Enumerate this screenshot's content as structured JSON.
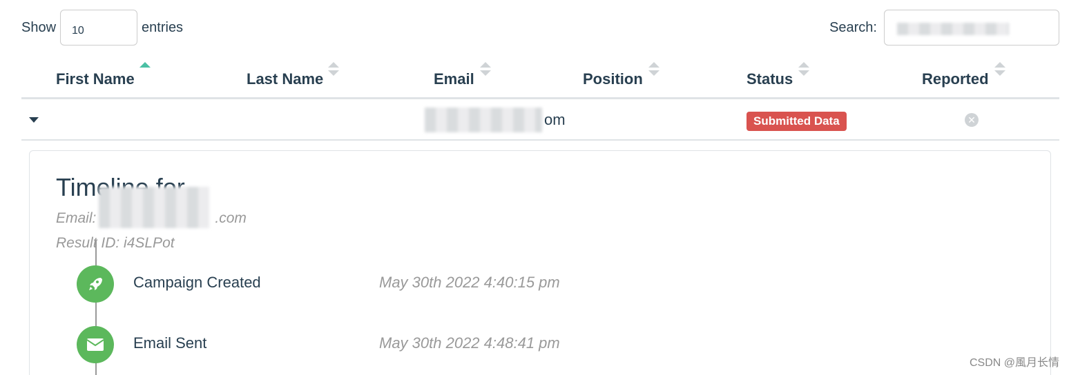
{
  "length_control": {
    "show_label": "Show",
    "value": "10",
    "entries_label": "entries"
  },
  "search": {
    "label": "Search:"
  },
  "columns": [
    {
      "label": "First Name"
    },
    {
      "label": "Last Name"
    },
    {
      "label": "Email"
    },
    {
      "label": "Position"
    },
    {
      "label": "Status"
    },
    {
      "label": "Reported"
    }
  ],
  "row": {
    "email_visible_suffix": "om",
    "status": "Submitted Data",
    "status_color": "#d9534f"
  },
  "timeline": {
    "title": "Timeline for",
    "email_prefix": "Email:",
    "email_visible_suffix": ".com",
    "result_id": "Result ID: i4SLPot",
    "events": [
      {
        "label": "Campaign Created",
        "time": "May 30th 2022 4:40:15 pm",
        "icon": "rocket-icon"
      },
      {
        "label": "Email Sent",
        "time": "May 30th 2022 4:48:41 pm",
        "icon": "envelope-icon"
      }
    ]
  },
  "watermark": "CSDN @風月长情",
  "colors": {
    "accent": "#4bc0a4",
    "event_green": "#5cb85c"
  }
}
